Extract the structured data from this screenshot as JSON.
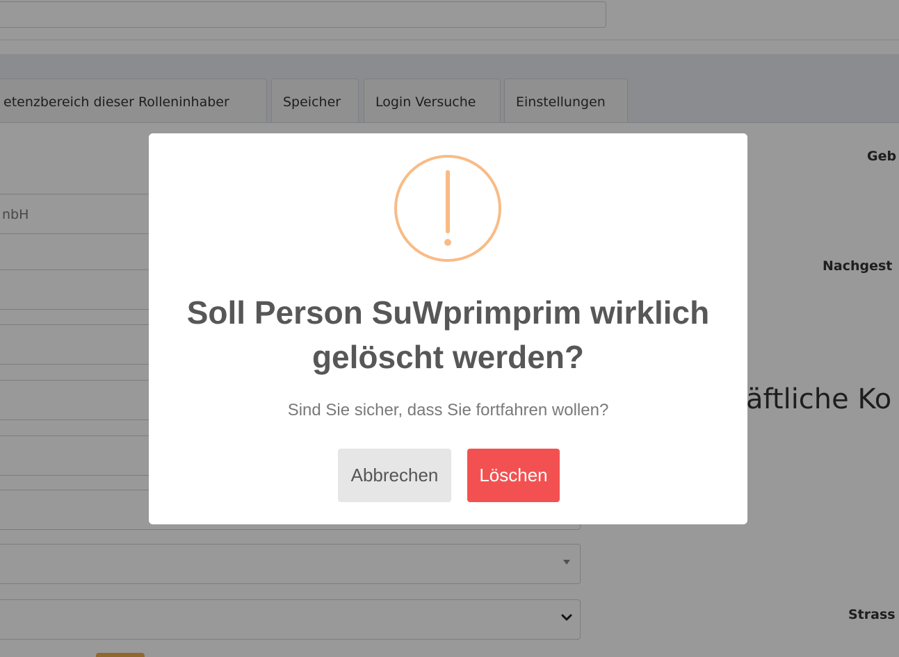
{
  "tabs": [
    {
      "label": "etenzbereich dieser Rolleninhaber"
    },
    {
      "label": "Speicher"
    },
    {
      "label": "Login Versuche"
    },
    {
      "label": "Einstellungen"
    }
  ],
  "background": {
    "company_field_partial": "nbH",
    "right_labels": {
      "label1": "Geb",
      "label2": "Nachgest",
      "label3": "Strass"
    },
    "right_heading_partial": "äftliche Ko"
  },
  "dialog": {
    "title": "Soll Person SuWprimprim wirklich gelöscht werden?",
    "text": "Sind Sie sicher, dass Sie fortfahren wollen?",
    "cancel_label": "Abbrechen",
    "confirm_label": "Löschen",
    "icon": "warning-icon",
    "colors": {
      "icon": "#f8bb86",
      "confirm": "#f35151",
      "cancel": "#e6e6e6"
    }
  }
}
